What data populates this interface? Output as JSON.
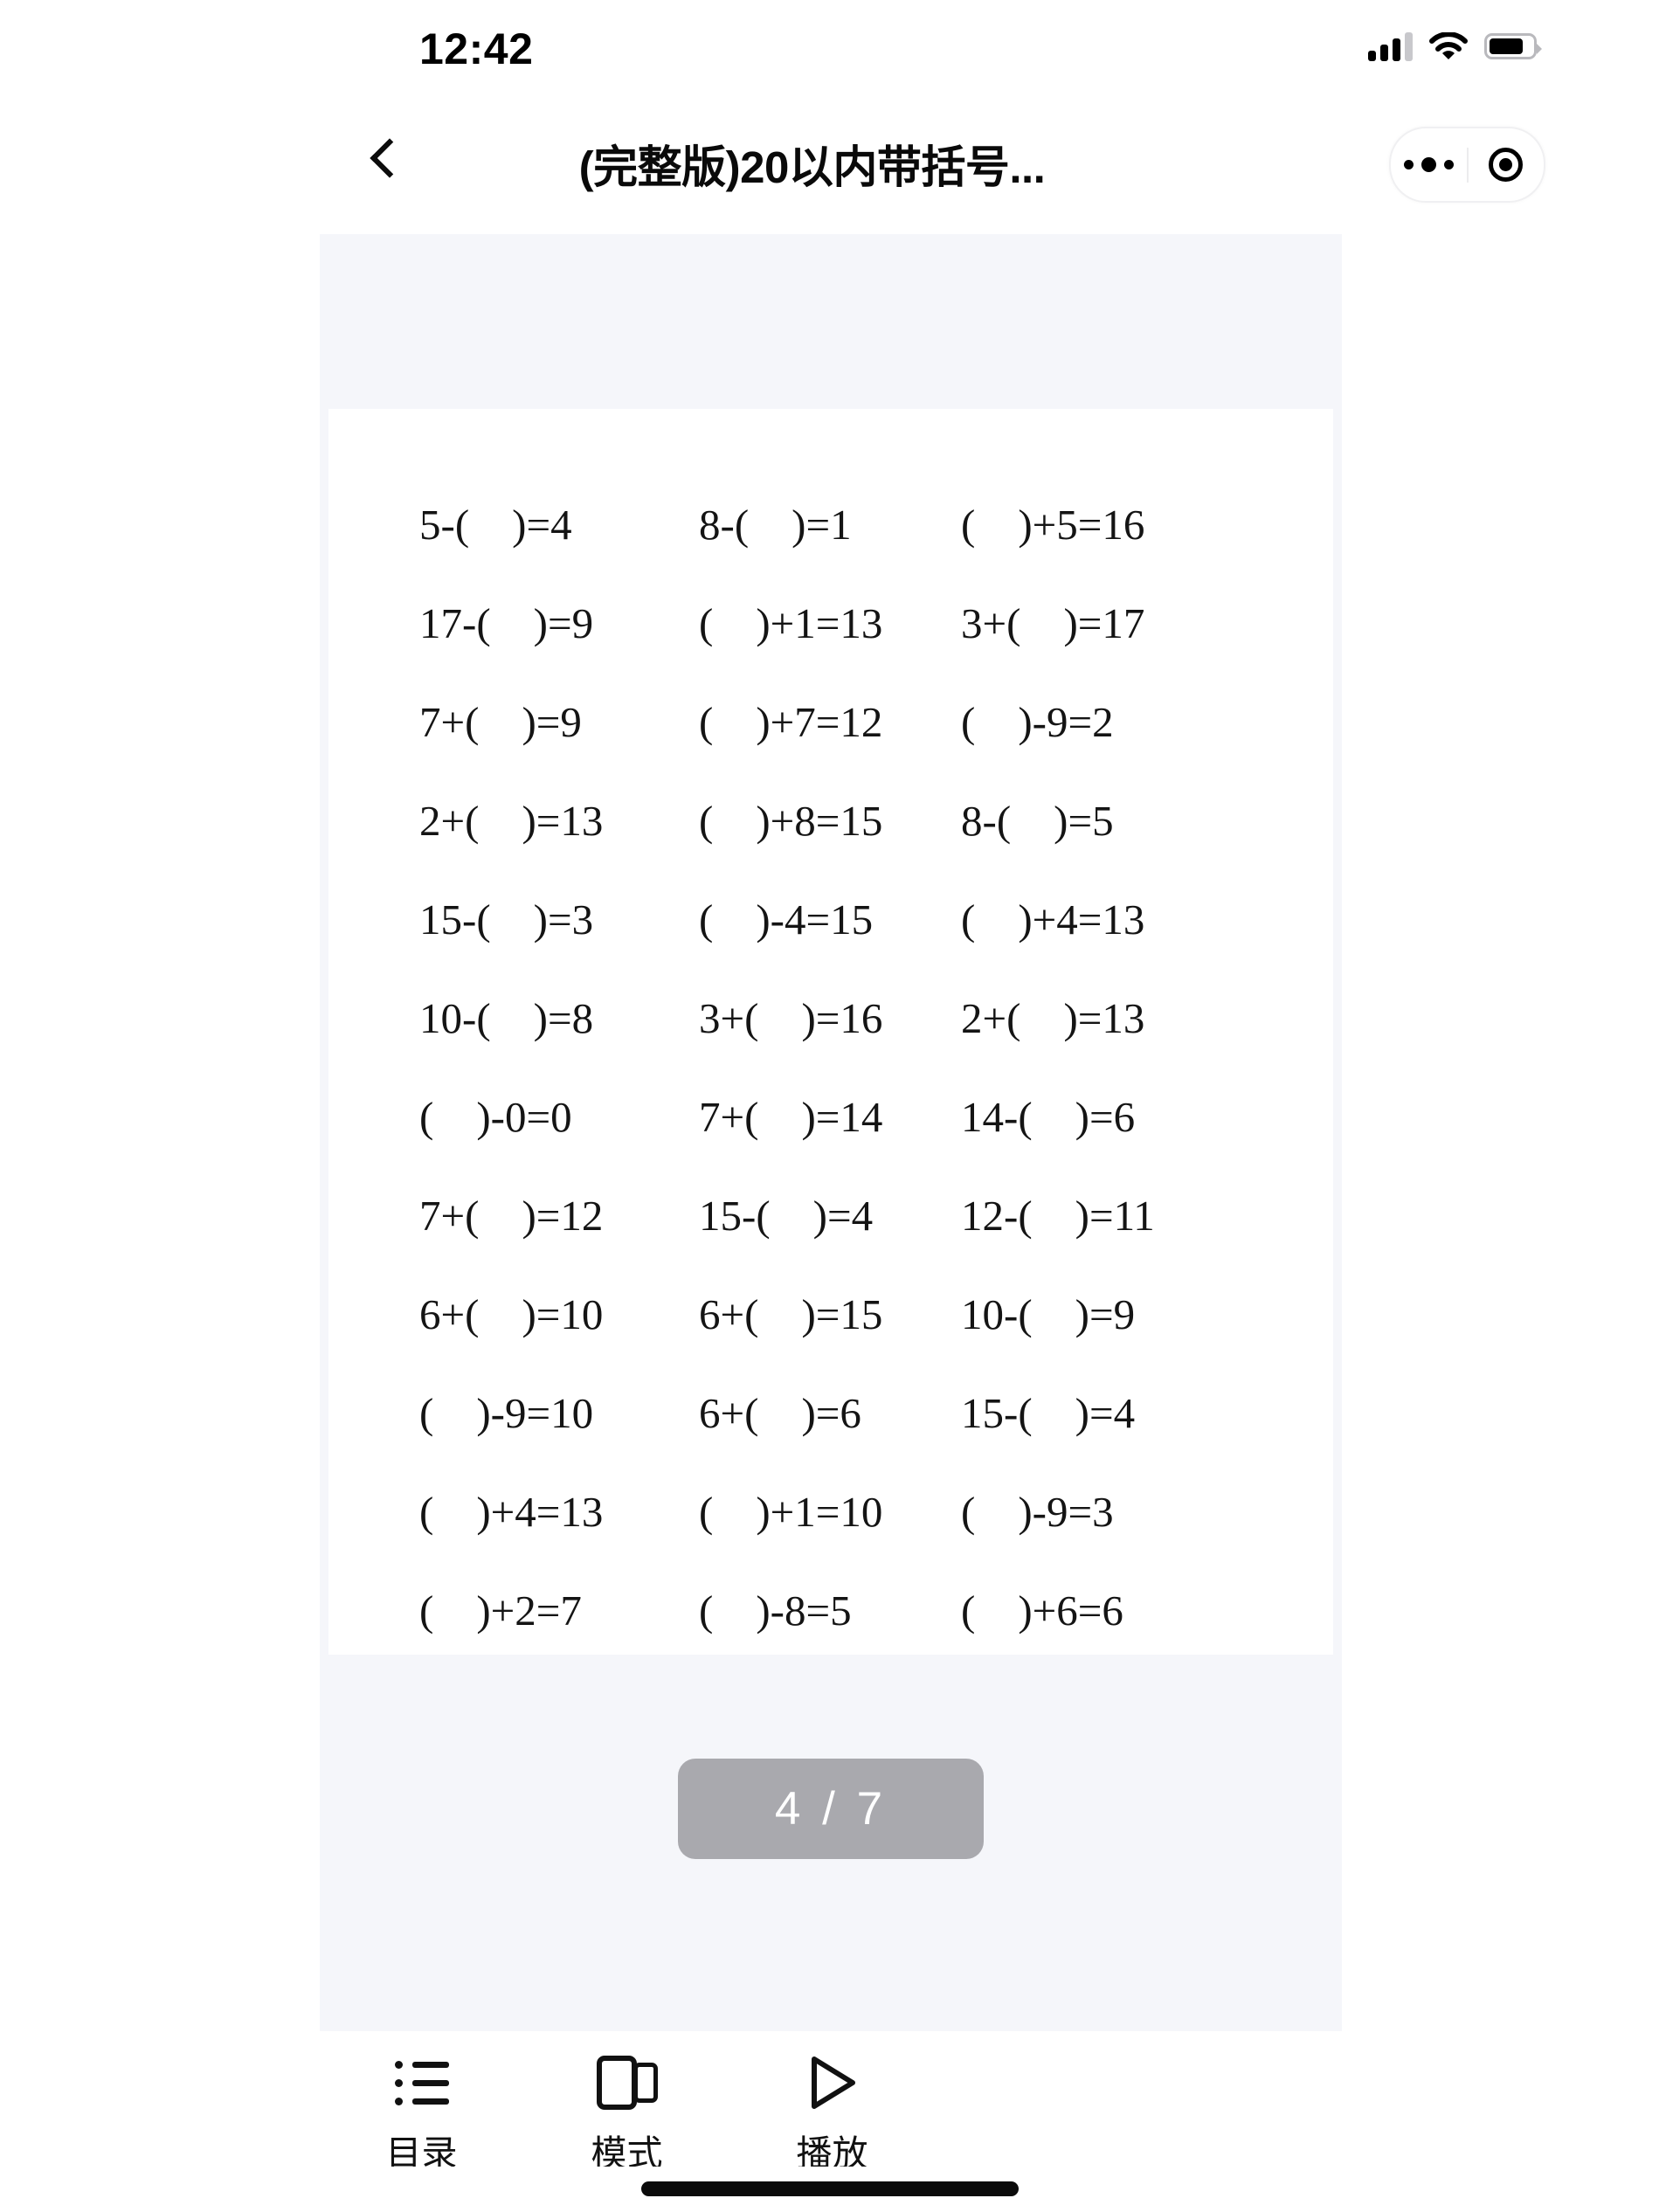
{
  "status_bar": {
    "time": "12:42",
    "signal_icon": "cellular-signal-icon",
    "signal_bars_filled": 3,
    "signal_bars_total": 4,
    "wifi_icon": "wifi-icon",
    "battery_icon": "battery-icon",
    "battery_level_percent": 80
  },
  "nav_bar": {
    "back_icon": "chevron-left-icon",
    "title": "(完整版)20以内带括号...",
    "capsule": {
      "more_icon": "more-dots-icon",
      "target_icon": "target-circle-icon"
    }
  },
  "document": {
    "page_indicator": "4 / 7",
    "current_page": 4,
    "total_pages": 7,
    "problems": [
      [
        "5-(    )=4",
        "8-(    )=1",
        "(    )+5=16"
      ],
      [
        "17-(    )=9",
        "(    )+1=13",
        "3+(    )=17"
      ],
      [
        "7+(    )=9",
        "(    )+7=12",
        "(    )-9=2"
      ],
      [
        "2+(    )=13",
        "(    )+8=15",
        "8-(    )=5"
      ],
      [
        "15-(    )=3",
        "(    )-4=15",
        "(    )+4=13"
      ],
      [
        "10-(    )=8",
        "3+(    )=16",
        "2+(    )=13"
      ],
      [
        "(    )-0=0",
        "7+(    )=14",
        "14-(    )=6"
      ],
      [
        "7+(    )=12",
        "15-(    )=4",
        "12-(    )=11"
      ],
      [
        "6+(    )=10",
        "6+(    )=15",
        "10-(    )=9"
      ],
      [
        "(    )-9=10",
        "6+(    )=6",
        "15-(    )=4"
      ],
      [
        "(    )+4=13",
        "(    )+1=10",
        "(    )-9=3"
      ],
      [
        "(    )+2=7",
        "(    )-8=5",
        "(    )+6=6"
      ]
    ]
  },
  "toolbar": {
    "items": [
      {
        "label": "目录",
        "icon": "list-icon"
      },
      {
        "label": "模式",
        "icon": "cards-icon"
      },
      {
        "label": "播放",
        "icon": "play-icon"
      }
    ]
  },
  "colors": {
    "container_bg": "#f5f6fa",
    "page_bg": "#ffffff",
    "pill_bg": "#a9a9ae",
    "pill_text": "#ffffff",
    "text": "#141414"
  }
}
